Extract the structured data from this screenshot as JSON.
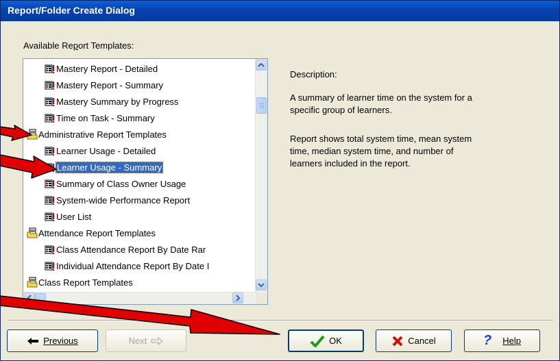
{
  "window": {
    "title": "Report/Folder Create Dialog"
  },
  "templates_label": "Available Report Templates:",
  "tree": {
    "items": [
      {
        "label": "Mastery Report - Detailed",
        "type": "report"
      },
      {
        "label": "Mastery Report - Summary",
        "type": "report"
      },
      {
        "label": "Mastery Summary by Progress",
        "type": "report"
      },
      {
        "label": "Time on Task - Summary",
        "type": "report"
      },
      {
        "label": "Administrative Report Templates",
        "type": "folder"
      },
      {
        "label": "Learner Usage - Detailed",
        "type": "report"
      },
      {
        "label": "Learner Usage - Summary",
        "type": "report",
        "selected": true
      },
      {
        "label": "Summary of Class Owner Usage",
        "type": "report"
      },
      {
        "label": "System-wide Performance Report",
        "type": "report"
      },
      {
        "label": "User List",
        "type": "report"
      },
      {
        "label": "Attendance Report Templates",
        "type": "folder"
      },
      {
        "label": "Class Attendance Report By Date Rar",
        "type": "report"
      },
      {
        "label": "Individual Attendance Report By Date I",
        "type": "report"
      },
      {
        "label": "Class Report Templates",
        "type": "folder"
      }
    ]
  },
  "description": {
    "heading": "Description:",
    "line1": "A summary of learner time on the system for a",
    "line2": "specific group of learners.",
    "line3": "Report shows total system time, mean system",
    "line4": "time, median system time, and number of",
    "line5": "learners included in the report."
  },
  "buttons": {
    "previous": "Previous",
    "next": "Next",
    "ok": "OK",
    "cancel": "Cancel",
    "help": "Help"
  },
  "colors": {
    "title_bar": "#0842b0",
    "selection": "#316ac5",
    "annotation_arrow": "#e00000"
  }
}
